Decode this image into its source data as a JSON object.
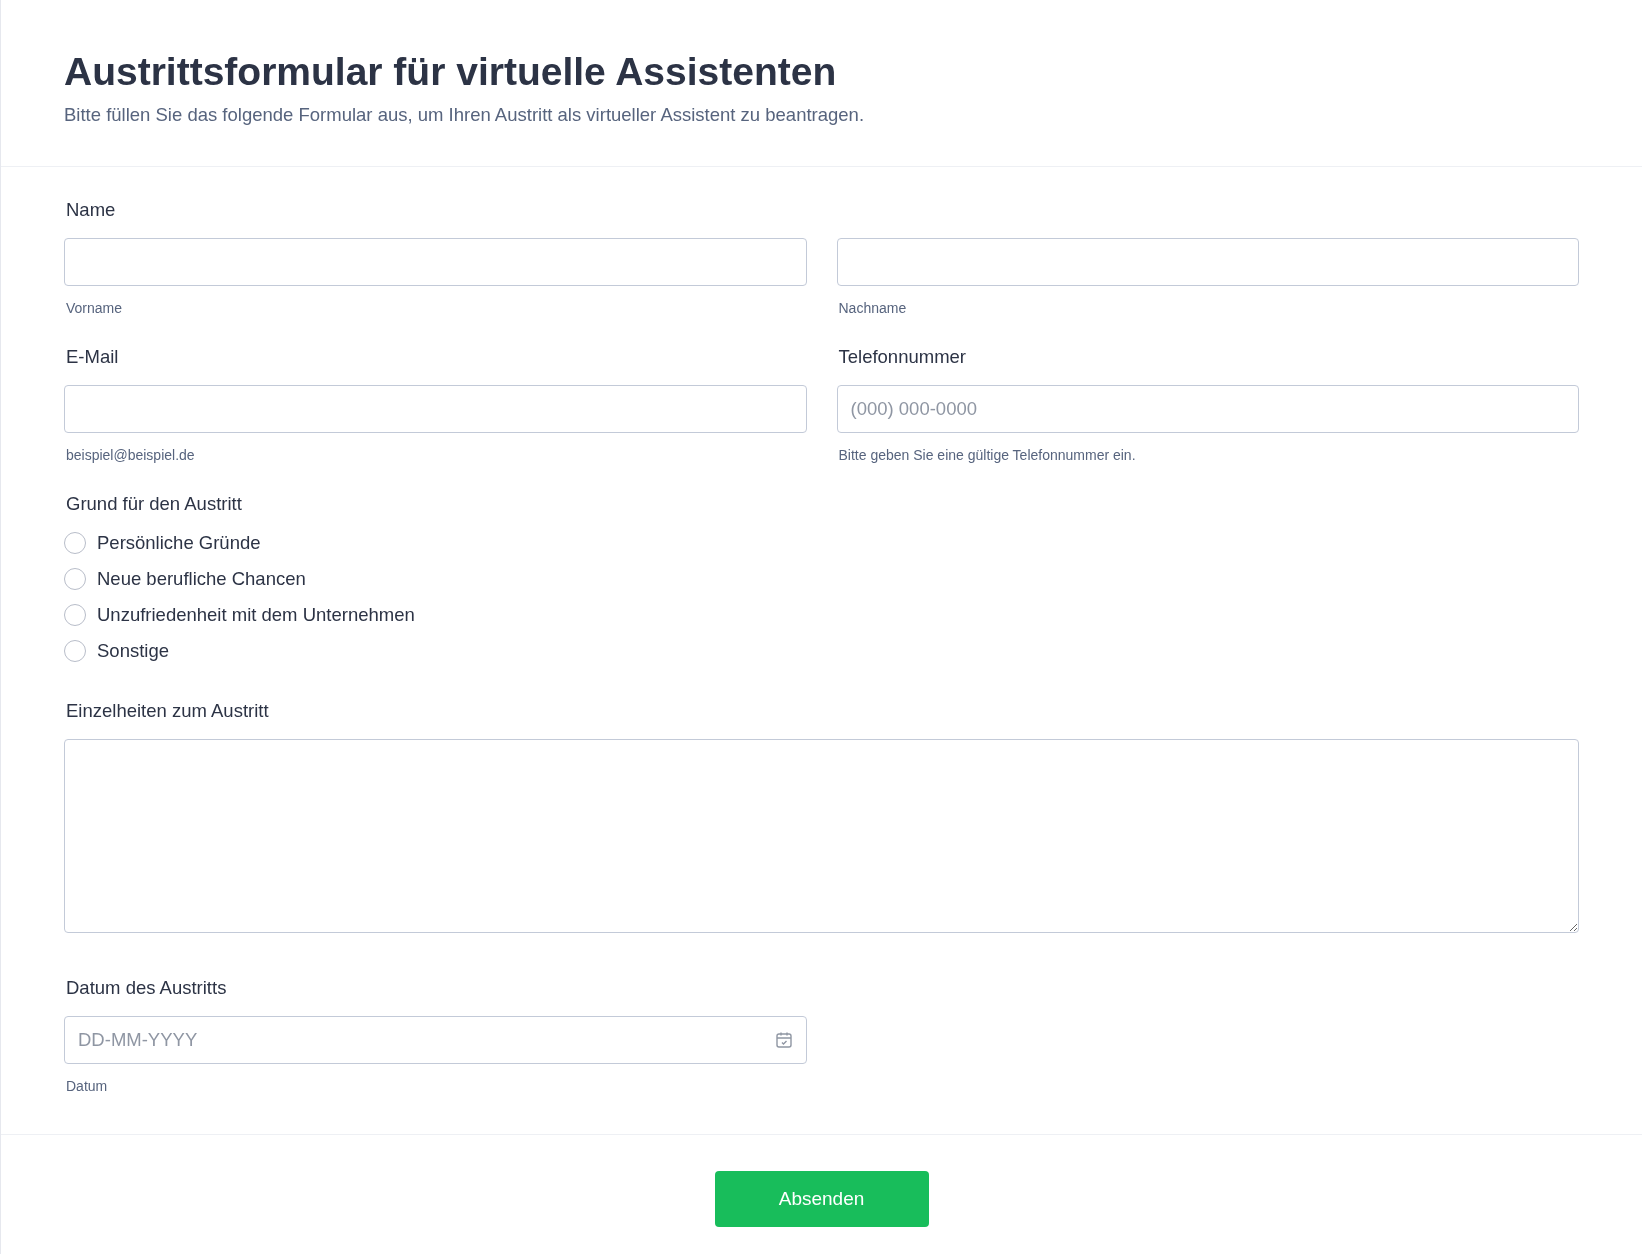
{
  "header": {
    "title": "Austrittsformular für virtuelle Assistenten",
    "subtitle": "Bitte füllen Sie das folgende Formular aus, um Ihren Austritt als virtueller Assistent zu beantragen."
  },
  "name": {
    "label": "Name",
    "fields": [
      {
        "sublabel": "Vorname"
      },
      {
        "sublabel": "Nachname"
      }
    ]
  },
  "contact": [
    {
      "label": "E-Mail",
      "sublabel": "beispiel@beispiel.de"
    },
    {
      "label": "Telefonnummer",
      "placeholder": "(000) 000-0000",
      "sublabel": "Bitte geben Sie eine gültige Telefonnummer ein."
    }
  ],
  "reason": {
    "label": "Grund für den Austritt",
    "options": [
      {
        "label": "Persönliche Gründe",
        "selected": false
      },
      {
        "label": "Neue berufliche Chancen",
        "selected": false
      },
      {
        "label": "Unzufriedenheit mit dem Unternehmen",
        "selected": false
      },
      {
        "label": "Sonstige",
        "selected": false
      }
    ]
  },
  "details": {
    "label": "Einzelheiten zum Austritt"
  },
  "date": {
    "label": "Datum des Austritts",
    "placeholder": "DD-MM-YYYY",
    "sublabel": "Datum"
  },
  "submit": "Absenden"
}
